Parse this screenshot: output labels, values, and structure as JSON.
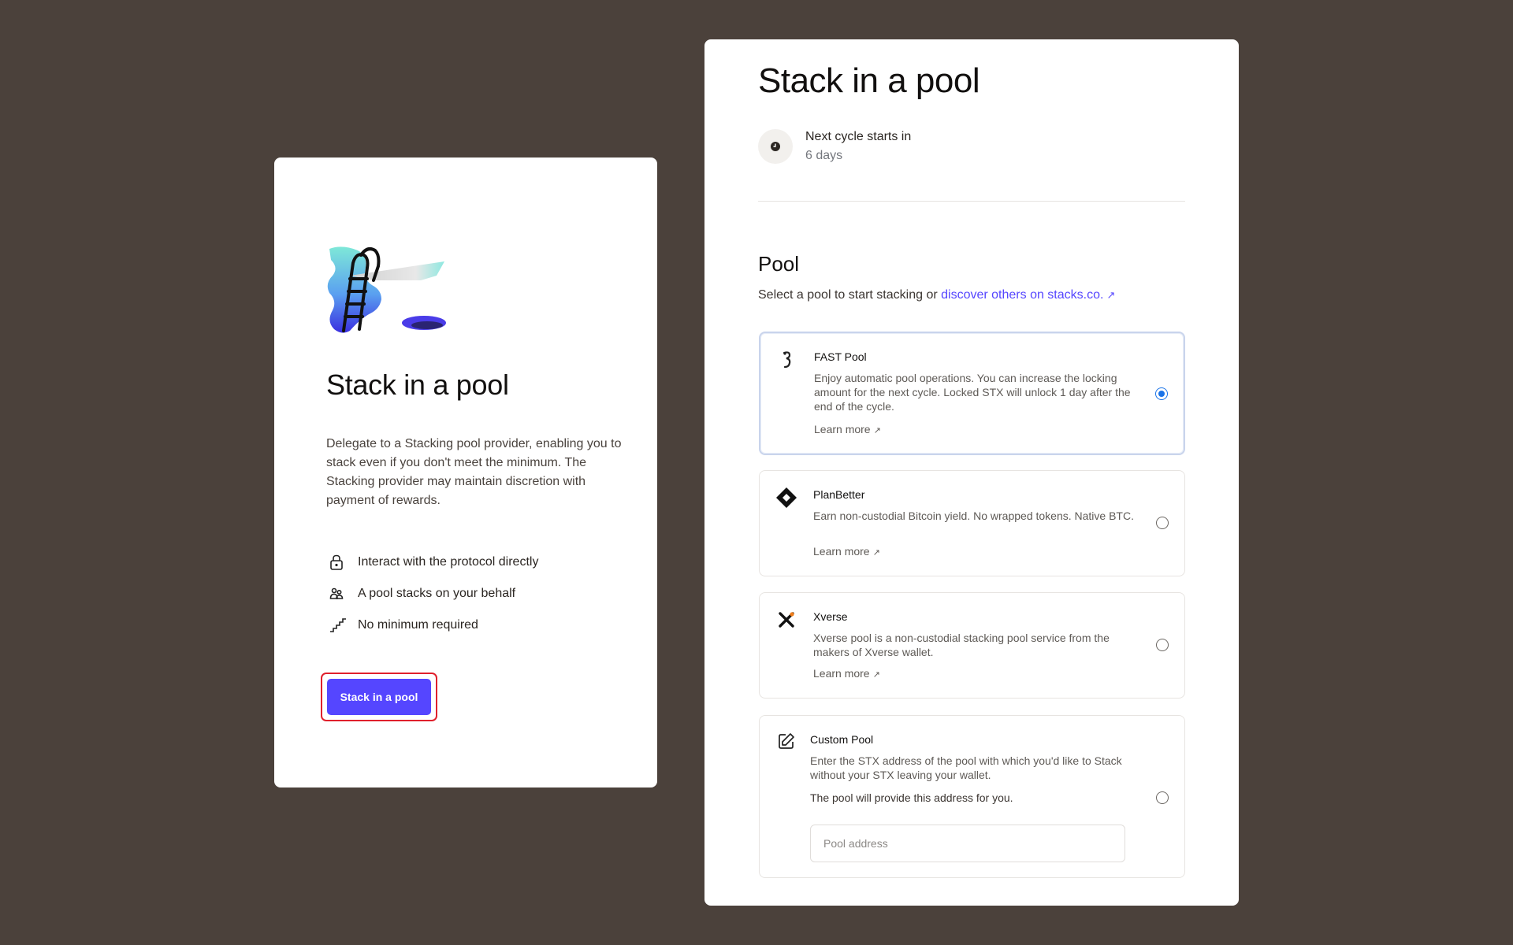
{
  "intro": {
    "title": "Stack in a pool",
    "description": "Delegate to a Stacking pool provider, enabling you to stack even if you don't meet the minimum. The Stacking provider may maintain discretion with payment of rewards.",
    "features": [
      {
        "icon": "lock-icon",
        "label": "Interact with the protocol directly"
      },
      {
        "icon": "people-icon",
        "label": "A pool stacks on your behalf"
      },
      {
        "icon": "stairs-icon",
        "label": "No minimum required"
      }
    ],
    "cta_label": "Stack in a pool"
  },
  "panel": {
    "title": "Stack in a pool",
    "cycle_label": "Next cycle starts in",
    "cycle_value": "6 days",
    "pool_heading": "Pool",
    "pool_sub_text": "Select a pool to start stacking or ",
    "pool_sub_link": "discover others on stacks.co.",
    "pools": [
      {
        "name": "FAST Pool",
        "icon": "fast-pool-icon",
        "description": "Enjoy automatic pool operations. You can increase the locking amount for the next cycle. Locked STX will unlock 1 day after the end of the cycle.",
        "learn_more": "Learn more",
        "selected": true
      },
      {
        "name": "PlanBetter",
        "icon": "planbetter-icon",
        "description": "Earn non-custodial Bitcoin yield. No wrapped tokens. Native BTC.",
        "learn_more": "Learn more",
        "selected": false
      },
      {
        "name": "Xverse",
        "icon": "xverse-icon",
        "description": "Xverse pool is a non-custodial stacking pool service from the makers of Xverse wallet.",
        "learn_more": "Learn more",
        "selected": false
      }
    ],
    "custom_pool": {
      "name": "Custom Pool",
      "icon": "edit-icon",
      "description": "Enter the STX address of the pool with which you'd like to Stack without your STX leaving your wallet.",
      "note": "The pool will provide this address for you.",
      "placeholder": "Pool address",
      "value": "",
      "selected": false
    }
  },
  "colors": {
    "background": "#4b413b",
    "accent": "#5546ff",
    "cta_outline": "#e0202c",
    "radio_selected": "#1a73e8"
  }
}
